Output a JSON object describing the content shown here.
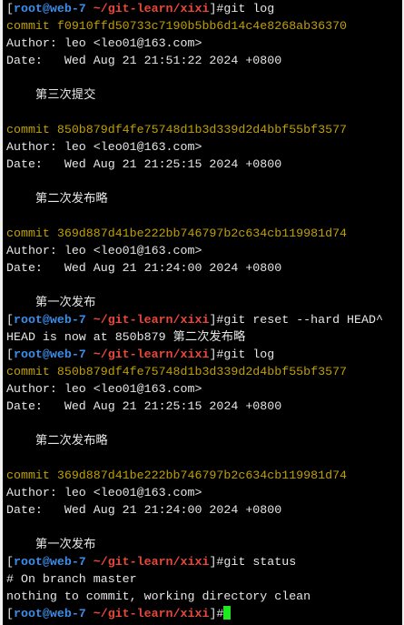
{
  "prompt": {
    "user_host": "root@web-7",
    "path": "~/git-learn/xixi",
    "open": "[",
    "close": "]#"
  },
  "colors": {
    "user": "#3b8eea",
    "path": "#e8473a",
    "commit": "#c0a000",
    "text": "#e6e6e6",
    "cursor": "#1ee81e"
  },
  "lines": [
    {
      "type": "prompt",
      "text": "git log"
    },
    {
      "type": "commit",
      "text": "commit f0910ffd50733c7190b5bb6d14c4e8268ab36370"
    },
    {
      "type": "text",
      "text": "Author: leo <leo01@163.com>"
    },
    {
      "type": "text",
      "text": "Date:   Wed Aug 21 21:51:22 2024 +0800"
    },
    {
      "type": "text",
      "text": ""
    },
    {
      "type": "text",
      "text": "    第三次提交"
    },
    {
      "type": "text",
      "text": ""
    },
    {
      "type": "commit",
      "text": "commit 850b879df4fe75748d1b3d339d2d4bbf55bf3577"
    },
    {
      "type": "text",
      "text": "Author: leo <leo01@163.com>"
    },
    {
      "type": "text",
      "text": "Date:   Wed Aug 21 21:25:15 2024 +0800"
    },
    {
      "type": "text",
      "text": ""
    },
    {
      "type": "text",
      "text": "    第二次发布略"
    },
    {
      "type": "text",
      "text": ""
    },
    {
      "type": "commit",
      "text": "commit 369d887d41be222bb746797b2c634cb119981d74"
    },
    {
      "type": "text",
      "text": "Author: leo <leo01@163.com>"
    },
    {
      "type": "text",
      "text": "Date:   Wed Aug 21 21:24:00 2024 +0800"
    },
    {
      "type": "text",
      "text": ""
    },
    {
      "type": "text",
      "text": "    第一次发布"
    },
    {
      "type": "prompt",
      "text": "git reset --hard HEAD^"
    },
    {
      "type": "text",
      "text": "HEAD is now at 850b879 第二次发布略"
    },
    {
      "type": "prompt",
      "text": "git log"
    },
    {
      "type": "commit",
      "text": "commit 850b879df4fe75748d1b3d339d2d4bbf55bf3577"
    },
    {
      "type": "text",
      "text": "Author: leo <leo01@163.com>"
    },
    {
      "type": "text",
      "text": "Date:   Wed Aug 21 21:25:15 2024 +0800"
    },
    {
      "type": "text",
      "text": ""
    },
    {
      "type": "text",
      "text": "    第二次发布略"
    },
    {
      "type": "text",
      "text": ""
    },
    {
      "type": "commit",
      "text": "commit 369d887d41be222bb746797b2c634cb119981d74"
    },
    {
      "type": "text",
      "text": "Author: leo <leo01@163.com>"
    },
    {
      "type": "text",
      "text": "Date:   Wed Aug 21 21:24:00 2024 +0800"
    },
    {
      "type": "text",
      "text": ""
    },
    {
      "type": "text",
      "text": "    第一次发布"
    },
    {
      "type": "prompt",
      "text": "git status"
    },
    {
      "type": "text",
      "text": "# On branch master"
    },
    {
      "type": "text",
      "text": "nothing to commit, working directory clean"
    },
    {
      "type": "prompt",
      "text": "",
      "cursor": true
    }
  ]
}
